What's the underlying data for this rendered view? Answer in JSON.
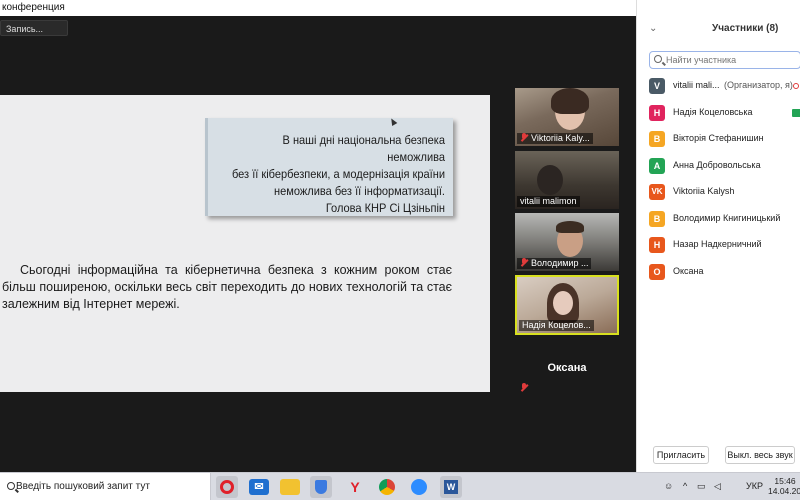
{
  "window": {
    "title": "конференция"
  },
  "recording": {
    "label": "Запись..."
  },
  "slide": {
    "quote_line1": "В наші дні національна безпека неможлива",
    "quote_line2": "без її кібербезпеки, а модернізація країни",
    "quote_line3": "неможлива без її інформатизації.",
    "quote_author": "Голова КНР Сі Цзіньпін",
    "body": "Сьогодні інформаційна та кібернетична безпека з кожним роком стає більш поширеною, оскільки весь світ переходить до нових технологій та стає залежним від Інтернет мережі."
  },
  "video_tiles": [
    {
      "name": "Viktoriia Kaly...",
      "muted": true
    },
    {
      "name": "vitalii malimon",
      "muted": false
    },
    {
      "name": "Володимир ...",
      "muted": true
    },
    {
      "name": "Надія Коцелов...",
      "muted": false,
      "active_speaker": true
    },
    {
      "name": "Оксана",
      "muted": true
    }
  ],
  "participants_panel": {
    "title": "Участники (8)",
    "search_placeholder": "Найти участника",
    "participants": [
      {
        "initial": "V",
        "name": "vitalii mali...",
        "role": "(Организатор, я)",
        "color": "#4a5a66"
      },
      {
        "initial": "Н",
        "name": "Надія Коцеловська",
        "role": "",
        "color": "#e0245e"
      },
      {
        "initial": "В",
        "name": "Вікторія Стефанишин",
        "role": "",
        "color": "#f5a623"
      },
      {
        "initial": "А",
        "name": " Анна Добровольська",
        "role": "",
        "color": "#23a455"
      },
      {
        "initial": "VK",
        "name": "Viktoriia Kalysh",
        "role": "",
        "color": "#e8571c"
      },
      {
        "initial": "В",
        "name": "Володимир Книгиницький",
        "role": "",
        "color": "#f5a623"
      },
      {
        "initial": "Н",
        "name": "Назар Надкерничний",
        "role": "",
        "color": "#e8571c"
      },
      {
        "initial": "О",
        "name": "Оксана",
        "role": "",
        "color": "#e8571c"
      }
    ],
    "invite_label": "Пригласить",
    "mute_all_label": "Выкл. весь звук"
  },
  "taskbar": {
    "search_text": "Введіть пошуковий запит тут",
    "language": "УКР",
    "time": "15:46",
    "date": "14.04.202"
  }
}
